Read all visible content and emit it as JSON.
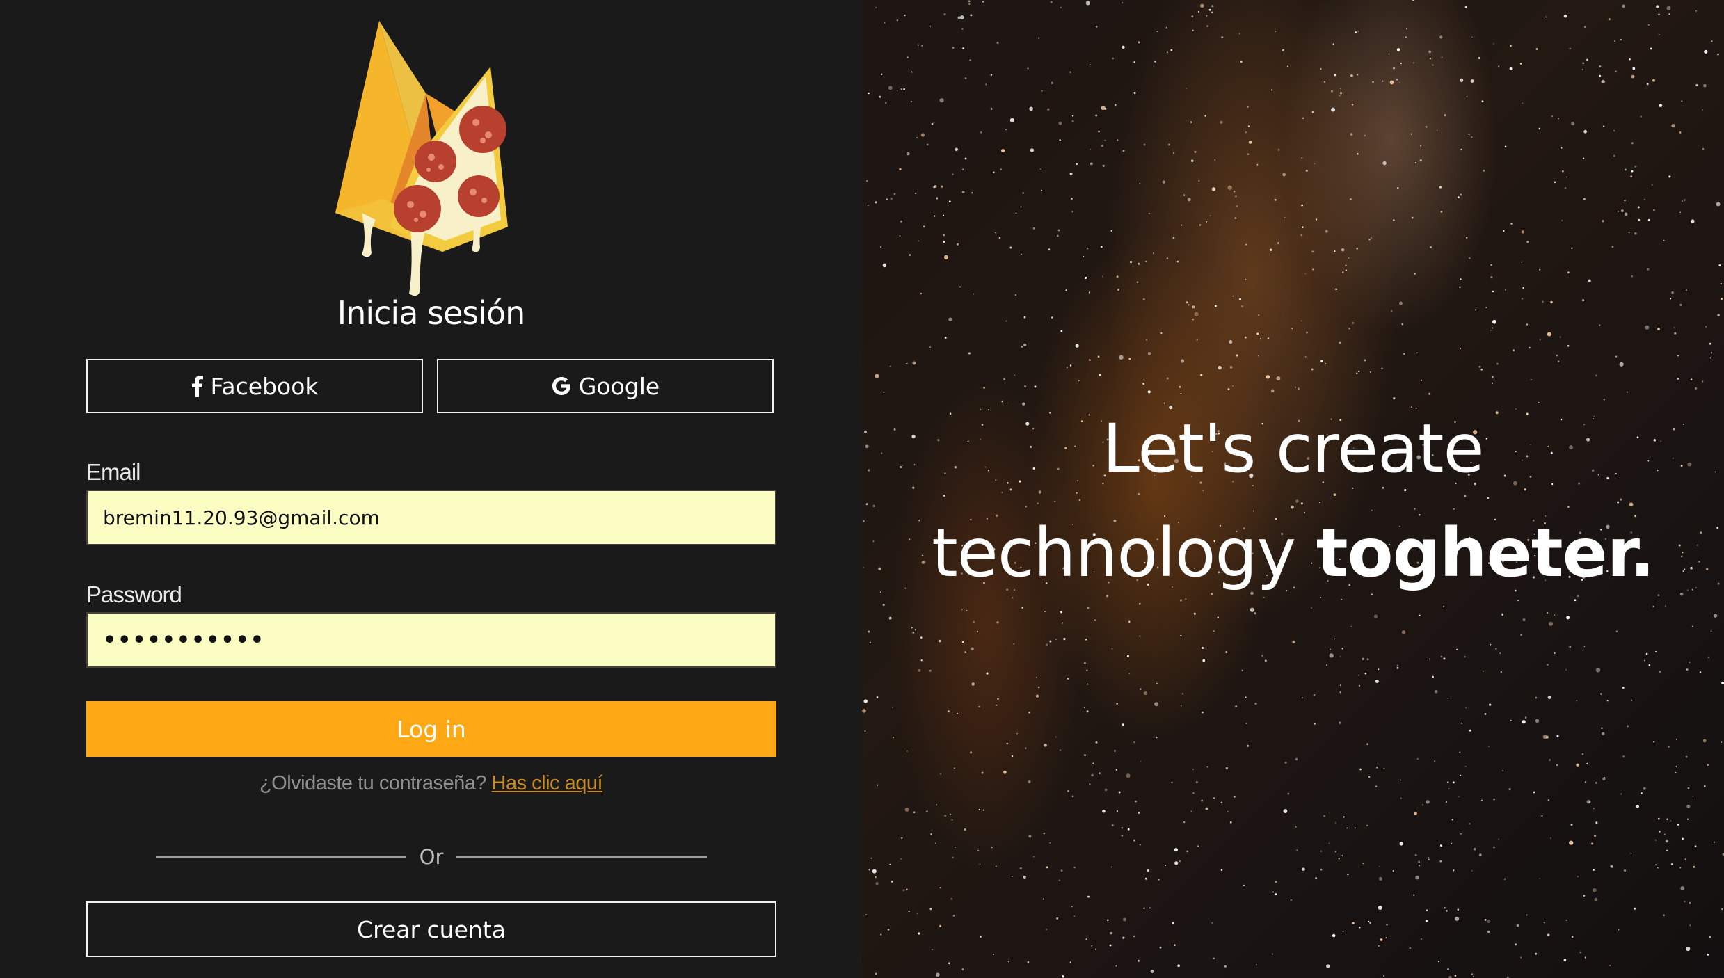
{
  "login": {
    "title": "Inicia sesión",
    "facebook_label": "Facebook",
    "google_label": "Google",
    "email_label": "Email",
    "email_value": "bremin11.20.93@gmail.com",
    "password_label": "Password",
    "password_value": "•••••••••••",
    "login_label": "Log in",
    "forgot_text": "¿Olvidaste tu contraseña?",
    "forgot_link": "Has clic aquí",
    "or_text": "Or",
    "create_label": "Crear cuenta"
  },
  "hero": {
    "line1": "Let's create",
    "line2_regular": "technology",
    "line2_bold": "togheter."
  },
  "icons": {
    "facebook": "facebook-icon",
    "google": "google-icon",
    "logo": "pizza-fire-logo"
  },
  "colors": {
    "background": "#1a1a1b",
    "accent": "#fea816",
    "input_background": "#fbfdc2",
    "link": "#c98d26"
  }
}
